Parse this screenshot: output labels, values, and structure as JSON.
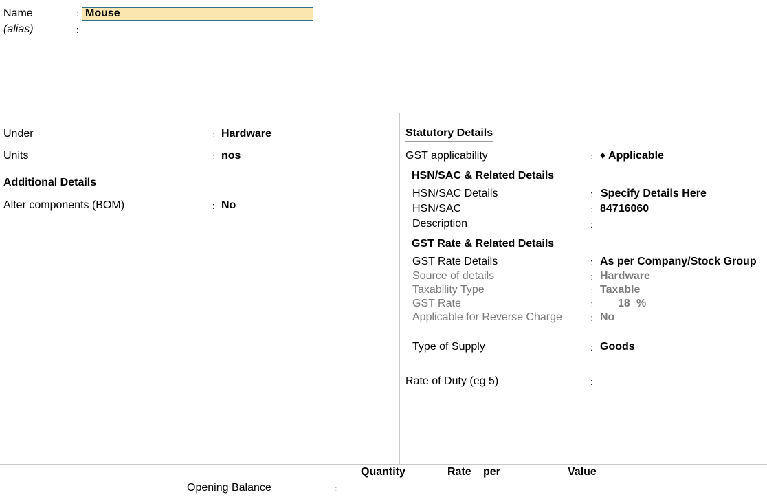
{
  "header": {
    "name_label": "Name",
    "name_value": "Mouse",
    "alias_label": "(alias)",
    "colon": ":"
  },
  "left": {
    "under_label": "Under",
    "under_value": "Hardware",
    "units_label": "Units",
    "units_value": "nos",
    "additional_details_heading": "Additional Details",
    "alter_components_label": "Alter components (BOM)",
    "alter_components_value": "No"
  },
  "right": {
    "statutory_heading": "Statutory Details",
    "gst_applicability_label": "GST applicability",
    "gst_applicability_value": "♦ Applicable",
    "hsn_section_heading": "HSN/SAC & Related Details",
    "hsn_details_label": "HSN/SAC Details",
    "hsn_details_value": "Specify Details Here",
    "hsn_label": "HSN/SAC",
    "hsn_value": "84716060",
    "description_label": "Description",
    "gst_rate_section_heading": "GST Rate & Related Details",
    "gst_rate_details_label": "GST Rate Details",
    "gst_rate_details_value": "As per Company/Stock Group",
    "source_label": "Source of details",
    "source_value": "Hardware",
    "taxability_label": "Taxability Type",
    "taxability_value": "Taxable",
    "gst_rate_label": "GST Rate",
    "gst_rate_value": "18",
    "gst_rate_unit": "%",
    "reverse_charge_label": "Applicable for Reverse Charge",
    "reverse_charge_value": "No",
    "type_of_supply_label": "Type of Supply",
    "type_of_supply_value": "Goods",
    "rate_of_duty_label": "Rate of Duty (eg 5)"
  },
  "footer": {
    "quantity_header": "Quantity",
    "rate_header": "Rate",
    "per_header": "per",
    "value_header": "Value",
    "opening_balance_label": "Opening Balance"
  },
  "colors": {
    "input_bg": "#fbe6b0",
    "input_border": "#2f6f8f",
    "muted_text": "#7a7a7a",
    "divider": "#c8c8c8"
  }
}
